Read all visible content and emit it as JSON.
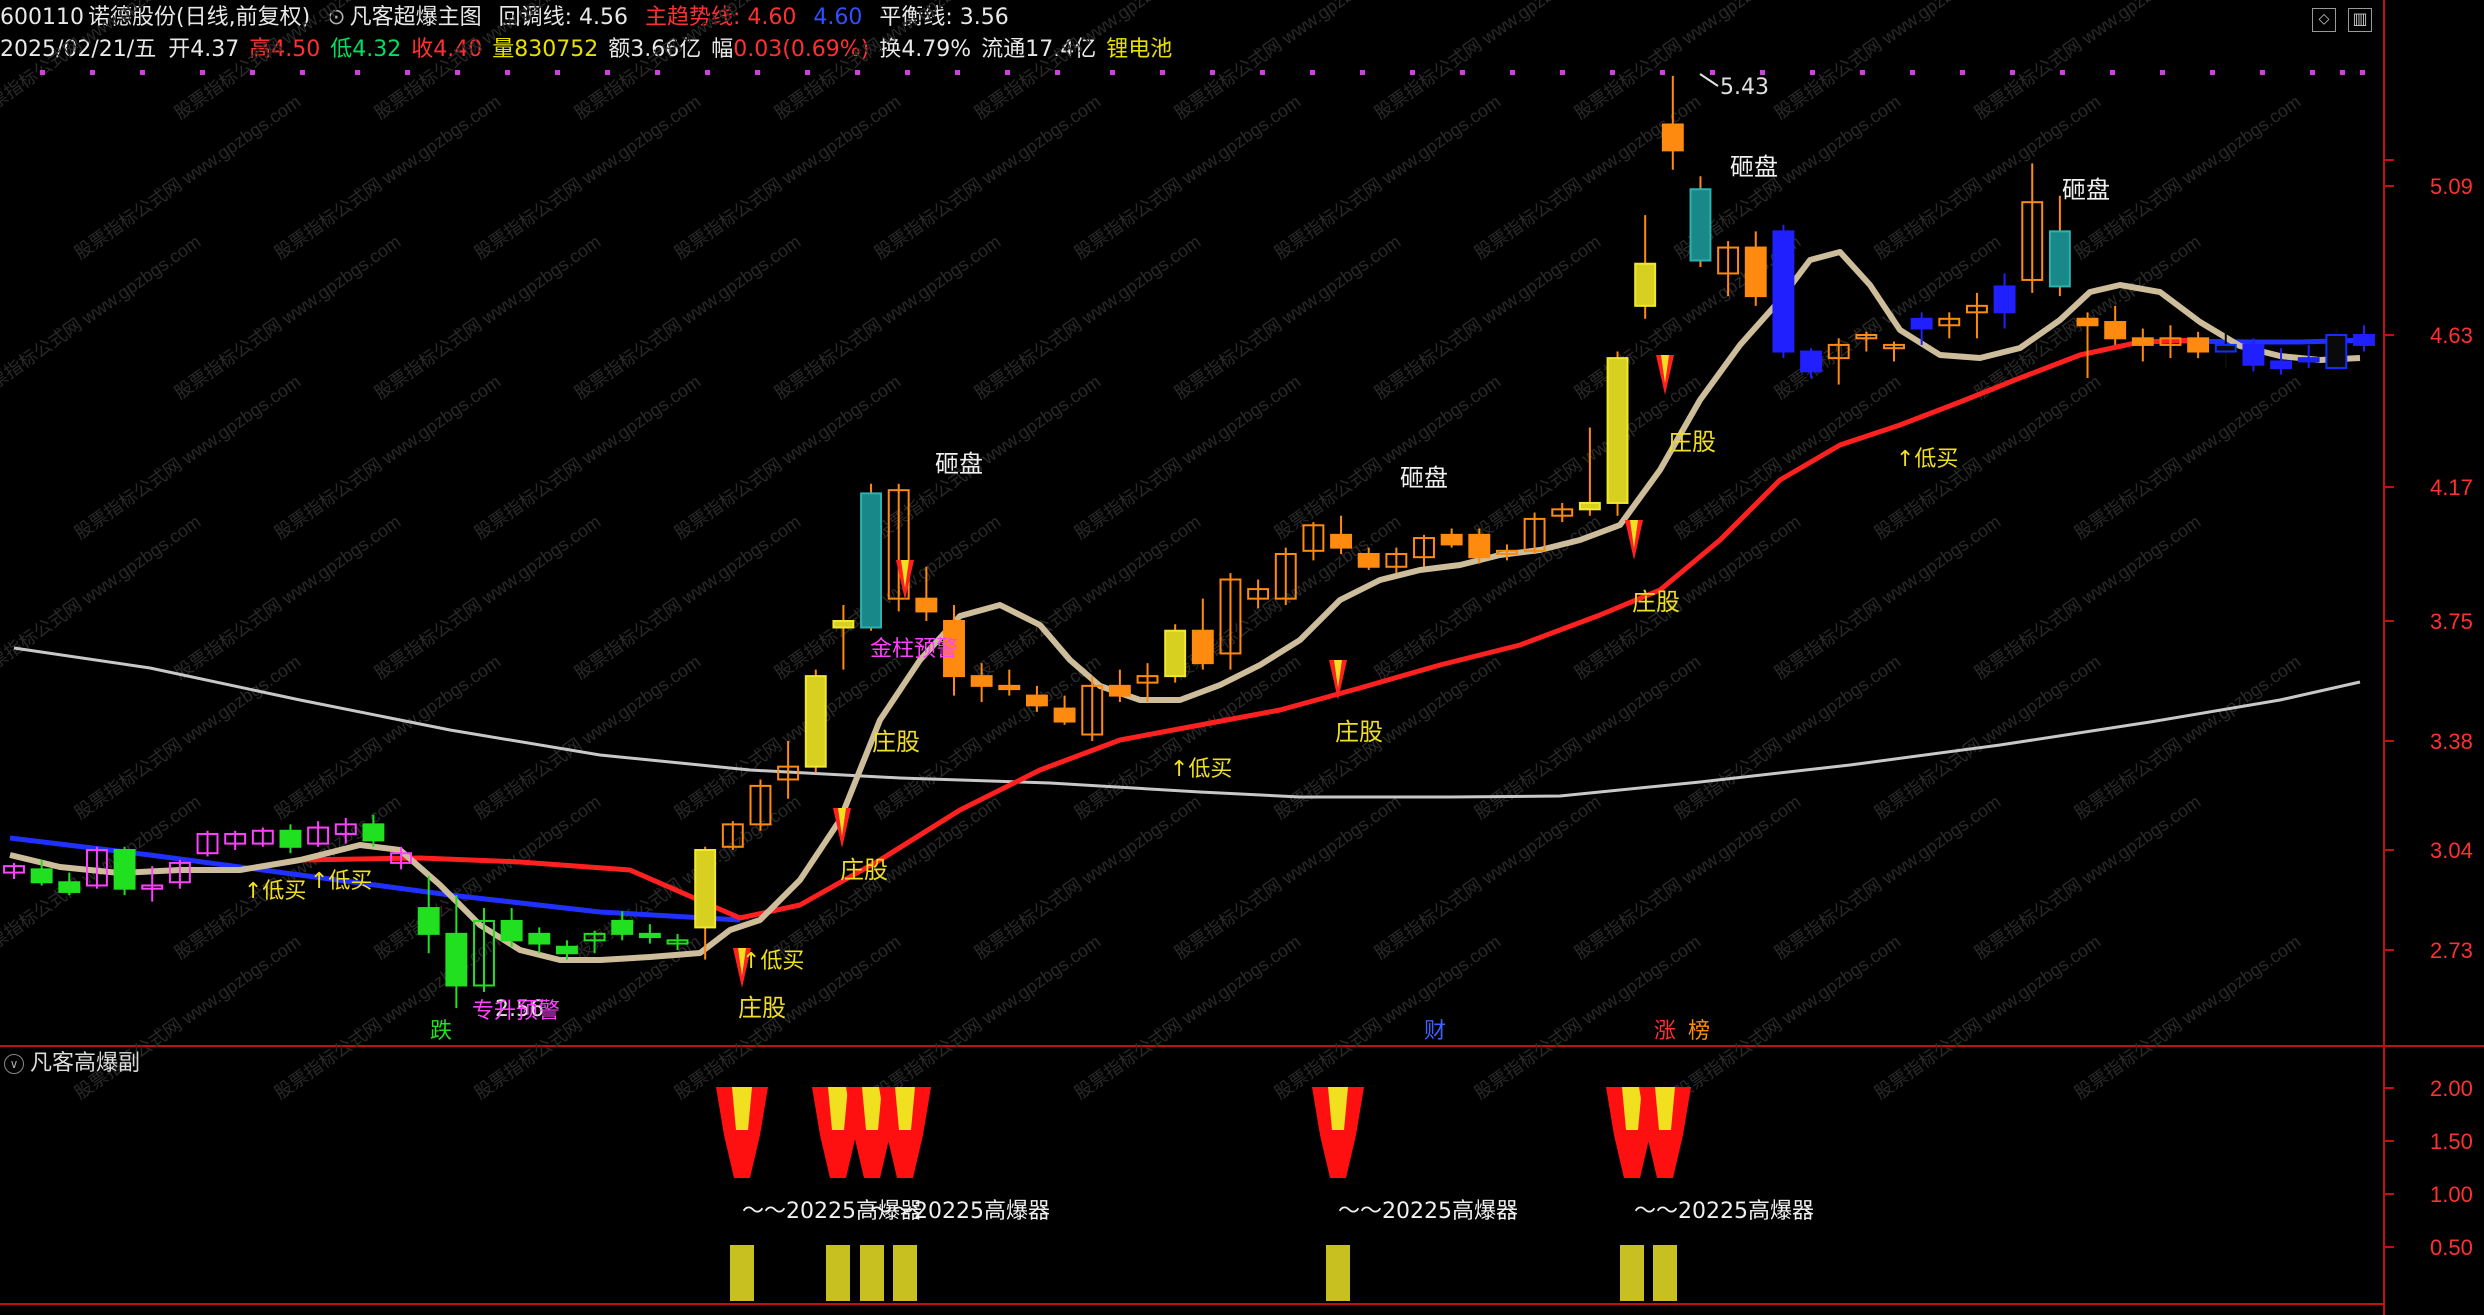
{
  "header": {
    "code": "600110",
    "name": "诺德股份",
    "period": "(日线,前复权)",
    "indicator_name": "凡客超爆主图",
    "lines": [
      {
        "label": "回调线: 4.56",
        "color": "#e8e8e8"
      },
      {
        "label": "主趋势线: 4.60",
        "color": "#ff3030"
      },
      {
        "label": "4.60",
        "color": "#3050ff"
      },
      {
        "label": "平衡线: 3.56",
        "color": "#e8e8e8"
      }
    ]
  },
  "quote": {
    "date": "2025/02/21/五",
    "open_label": "开",
    "open": "4.37",
    "high_label": "高",
    "high": "4.50",
    "low_label": "低",
    "low": "4.32",
    "close_label": "收",
    "close": "4.40",
    "volume_label": "量",
    "volume": "830752",
    "amount_label": "额",
    "amount": "3.66亿",
    "change_label": "幅",
    "change": "0.03(0.69%)",
    "turnover_label": "换",
    "turnover": "4.79%",
    "float_label": "流通",
    "float": "17.4亿",
    "concept": "锂电池"
  },
  "price_axis": [
    "5.09",
    "4.63",
    "4.17",
    "3.75",
    "3.38",
    "3.04",
    "2.73"
  ],
  "sub_axis": [
    "2.00",
    "1.50",
    "1.00",
    "0.50"
  ],
  "sub_panel": {
    "title": "凡客高爆副",
    "label": "～～20225高爆器"
  },
  "chart_annotations": {
    "high_mark": "5.43",
    "low_mark": "2.56",
    "crash": "砸盘",
    "banker": "庄股",
    "buy_low": "↑低买",
    "golden_pillar": "金柱预警",
    "warning": "专升预警",
    "fall": "跌",
    "finance": "财",
    "limit_up": "涨",
    "rank": "榜"
  },
  "watermark": "股票指标公式网 www.gpzbgs.com",
  "chart_data": {
    "type": "candlestick",
    "y_axis_ticks": [
      5.09,
      4.63,
      4.17,
      3.75,
      3.38,
      3.04,
      2.73
    ],
    "ohlc": [
      [
        2.97,
        3.0,
        2.95,
        2.99
      ],
      [
        2.98,
        3.01,
        2.93,
        2.94
      ],
      [
        2.94,
        2.97,
        2.9,
        2.91
      ],
      [
        2.93,
        3.05,
        2.92,
        3.04
      ],
      [
        3.04,
        3.05,
        2.9,
        2.92
      ],
      [
        2.92,
        2.99,
        2.88,
        2.93
      ],
      [
        2.94,
        3.01,
        2.92,
        3.0
      ],
      [
        3.03,
        3.1,
        3.02,
        3.09
      ],
      [
        3.06,
        3.1,
        3.04,
        3.09
      ],
      [
        3.06,
        3.11,
        3.05,
        3.1
      ],
      [
        3.1,
        3.12,
        3.03,
        3.05
      ],
      [
        3.06,
        3.13,
        3.05,
        3.11
      ],
      [
        3.09,
        3.14,
        3.06,
        3.12
      ],
      [
        3.12,
        3.15,
        3.05,
        3.07
      ],
      [
        3.0,
        3.05,
        2.98,
        3.03
      ],
      [
        2.86,
        2.96,
        2.72,
        2.78
      ],
      [
        2.78,
        2.9,
        2.55,
        2.62
      ],
      [
        2.62,
        2.86,
        2.6,
        2.82
      ],
      [
        2.82,
        2.86,
        2.74,
        2.76
      ],
      [
        2.78,
        2.8,
        2.72,
        2.75
      ],
      [
        2.74,
        2.76,
        2.7,
        2.72
      ],
      [
        2.76,
        2.79,
        2.72,
        2.78
      ],
      [
        2.82,
        2.85,
        2.76,
        2.78
      ],
      [
        2.78,
        2.81,
        2.75,
        2.77
      ],
      [
        2.75,
        2.78,
        2.73,
        2.76
      ],
      [
        2.8,
        3.05,
        2.7,
        3.04
      ],
      [
        3.05,
        3.13,
        3.04,
        3.12
      ],
      [
        3.12,
        3.26,
        3.1,
        3.24
      ],
      [
        3.26,
        3.38,
        3.2,
        3.3
      ],
      [
        3.3,
        3.6,
        3.28,
        3.58
      ],
      [
        3.75,
        3.8,
        3.6,
        3.73
      ],
      [
        3.73,
        4.18,
        3.72,
        4.15
      ],
      [
        3.82,
        4.18,
        3.78,
        4.16
      ],
      [
        3.82,
        3.92,
        3.75,
        3.78
      ],
      [
        3.75,
        3.8,
        3.52,
        3.58
      ],
      [
        3.58,
        3.62,
        3.5,
        3.55
      ],
      [
        3.55,
        3.6,
        3.52,
        3.54
      ],
      [
        3.52,
        3.55,
        3.47,
        3.49
      ],
      [
        3.48,
        3.52,
        3.43,
        3.44
      ],
      [
        3.4,
        3.58,
        3.38,
        3.55
      ],
      [
        3.55,
        3.6,
        3.5,
        3.52
      ],
      [
        3.56,
        3.62,
        3.5,
        3.58
      ],
      [
        3.58,
        3.74,
        3.56,
        3.72
      ],
      [
        3.72,
        3.82,
        3.6,
        3.62
      ],
      [
        3.65,
        3.9,
        3.6,
        3.88
      ],
      [
        3.82,
        3.88,
        3.79,
        3.85
      ],
      [
        3.82,
        3.98,
        3.8,
        3.96
      ],
      [
        3.97,
        4.06,
        3.94,
        4.05
      ],
      [
        4.02,
        4.08,
        3.96,
        3.98
      ],
      [
        3.96,
        3.98,
        3.91,
        3.92
      ],
      [
        3.92,
        3.98,
        3.9,
        3.96
      ],
      [
        3.95,
        4.02,
        3.92,
        4.01
      ],
      [
        4.02,
        4.04,
        3.98,
        3.99
      ],
      [
        4.02,
        4.04,
        3.93,
        3.95
      ],
      [
        3.96,
        3.99,
        3.94,
        3.97
      ],
      [
        3.97,
        4.09,
        3.96,
        4.07
      ],
      [
        4.08,
        4.12,
        4.06,
        4.1
      ],
      [
        4.1,
        4.35,
        4.08,
        4.12
      ],
      [
        4.12,
        4.58,
        4.08,
        4.56
      ],
      [
        4.85,
        5.0,
        4.68,
        4.72
      ],
      [
        5.28,
        5.43,
        5.14,
        5.2
      ],
      [
        5.08,
        5.12,
        4.84,
        4.86
      ],
      [
        4.82,
        4.92,
        4.75,
        4.9
      ],
      [
        4.9,
        4.95,
        4.72,
        4.75
      ],
      [
        4.95,
        4.97,
        4.56,
        4.58
      ],
      [
        4.58,
        4.59,
        4.5,
        4.52
      ],
      [
        4.56,
        4.62,
        4.48,
        4.6
      ],
      [
        4.62,
        4.64,
        4.58,
        4.63
      ],
      [
        4.59,
        4.61,
        4.55,
        4.6
      ],
      [
        4.68,
        4.7,
        4.6,
        4.65
      ],
      [
        4.66,
        4.7,
        4.62,
        4.68
      ],
      [
        4.7,
        4.76,
        4.62,
        4.72
      ],
      [
        4.78,
        4.82,
        4.65,
        4.7
      ],
      [
        4.8,
        5.16,
        4.76,
        5.04
      ],
      [
        4.95,
        5.06,
        4.75,
        4.78
      ],
      [
        4.68,
        4.7,
        4.5,
        4.66
      ],
      [
        4.67,
        4.72,
        4.6,
        4.62
      ],
      [
        4.62,
        4.65,
        4.55,
        4.6
      ],
      [
        4.6,
        4.66,
        4.56,
        4.62
      ],
      [
        4.62,
        4.64,
        4.56,
        4.58
      ],
      [
        4.58,
        4.64,
        4.53,
        4.6
      ],
      [
        4.6,
        4.62,
        4.52,
        4.54
      ],
      [
        4.55,
        4.59,
        4.51,
        4.53
      ],
      [
        4.56,
        4.6,
        4.53,
        4.55
      ],
      [
        4.53,
        4.65,
        4.52,
        4.63
      ],
      [
        4.63,
        4.66,
        4.58,
        4.6
      ]
    ]
  }
}
